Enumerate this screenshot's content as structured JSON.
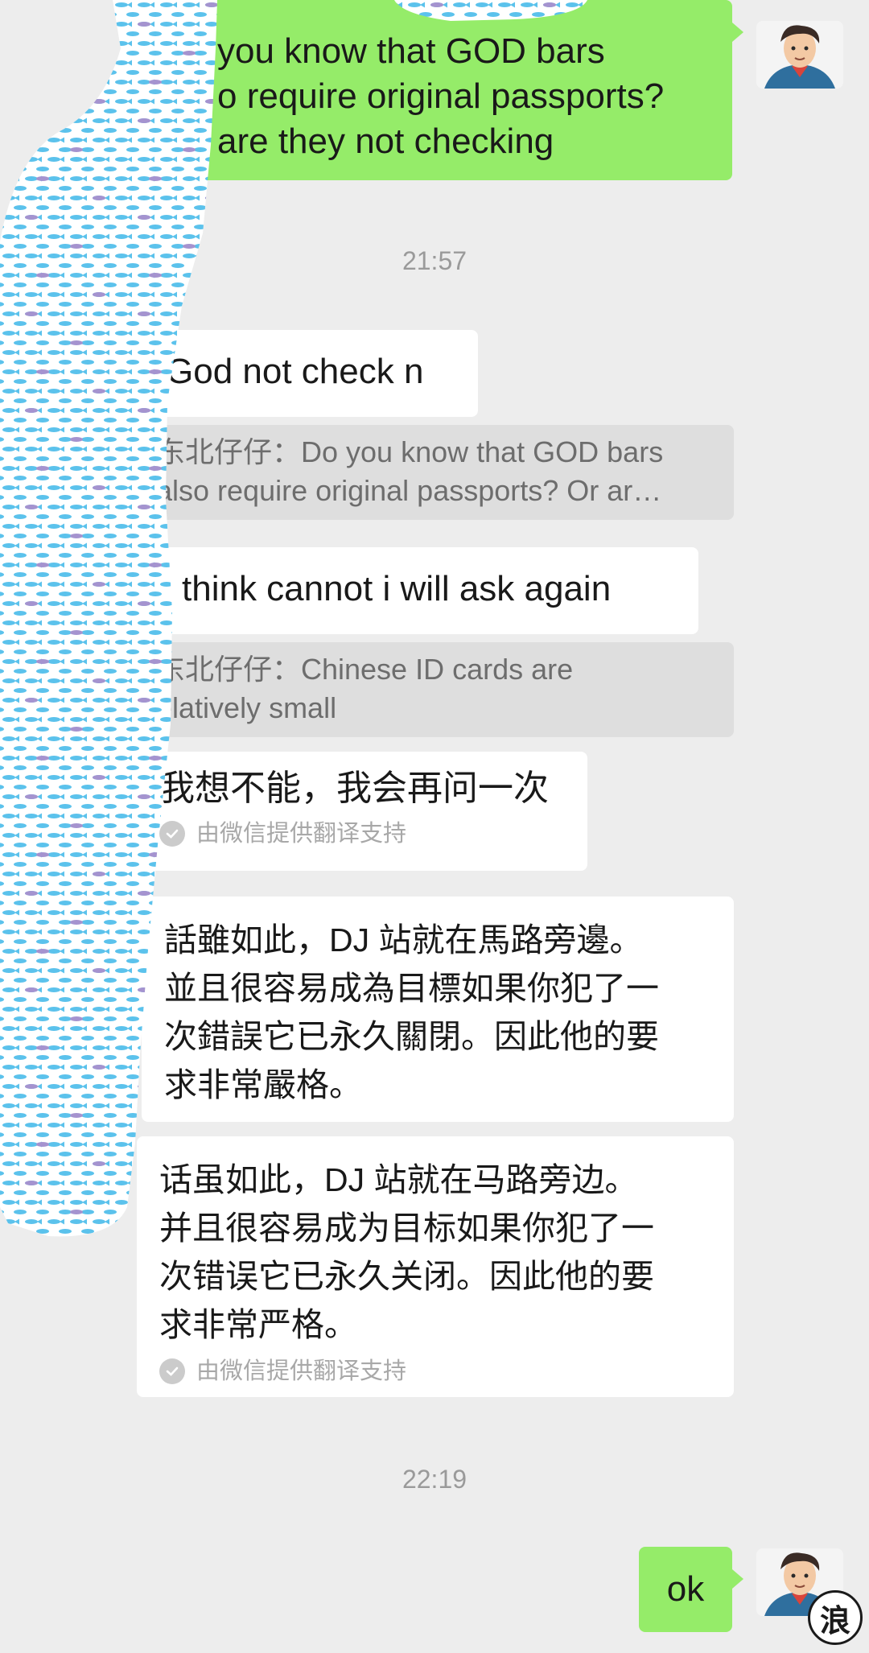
{
  "messages": {
    "m1": {
      "lines": [
        "you know that GOD bars",
        "o require original passports?",
        "are they not checking"
      ]
    },
    "t1": "21:57",
    "m2": {
      "text": "God not check n",
      "quote": [
        "东北仔仔：Do you know that GOD bars",
        "also require original passports? Or ar…"
      ]
    },
    "m3": {
      "text": "think cannot i will ask again",
      "quote": [
        "东北仔仔：Chinese ID cards are",
        "elatively small"
      ]
    },
    "m4": {
      "text": "我想不能，我会再问一次",
      "note": "由微信提供翻译支持"
    },
    "m5": {
      "lines": [
        "話雖如此，DJ 站就在馬路旁邊。",
        "並且很容易成為目標如果你犯了一",
        "次錯誤它已永久關閉。因此他的要",
        "求非常嚴格。"
      ]
    },
    "m6": {
      "lines": [
        "话虽如此，DJ 站就在马路旁边。",
        "并且很容易成为目标如果你犯了一",
        "次错误它已永久关闭。因此他的要",
        "求非常严格。"
      ],
      "note": "由微信提供翻译支持"
    },
    "t2": "22:19",
    "m7": {
      "text": "ok"
    }
  },
  "watermark": "浪",
  "colors": {
    "background": "#ededed",
    "sent_bubble": "#95ec69",
    "received_bubble": "#ffffff",
    "quote_bg": "#dedede",
    "redaction_blue": "#5bc2ec",
    "redaction_purple": "#a593cf"
  },
  "icons": {
    "avatar": "cartoon-man-avatar",
    "check": "check-circle-icon"
  }
}
